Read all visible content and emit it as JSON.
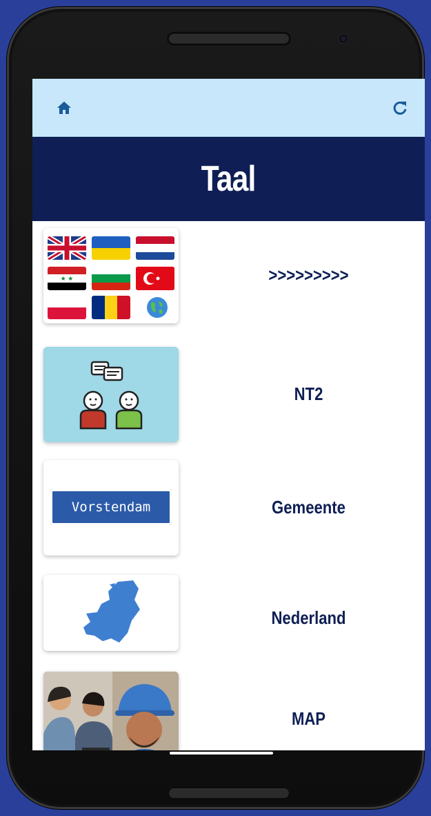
{
  "header": {
    "home_icon": "home-icon",
    "refresh_icon": "refresh-icon",
    "title": "Taal"
  },
  "items": [
    {
      "label": ">>>>>>>>>",
      "image": "flags-image"
    },
    {
      "label": "NT2",
      "image": "conversation-people-image"
    },
    {
      "label": "Gemeente",
      "image": "town-sign-image",
      "sign_text": "Vorstendam"
    },
    {
      "label": "Nederland",
      "image": "netherlands-map-image"
    },
    {
      "label": "MAP",
      "image": "workers-photo-image"
    }
  ],
  "colors": {
    "background": "#2a3f9a",
    "topbar": "#c8e7fa",
    "titlebar": "#0f1f55",
    "label": "#0f1f55"
  }
}
